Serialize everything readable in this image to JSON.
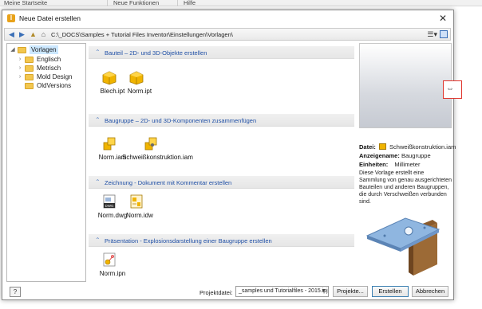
{
  "background_menu": {
    "items": [
      "Meine Startseite",
      "Neue Funktionen",
      "Hilfe"
    ]
  },
  "dialog": {
    "title": "Neue Datei erstellen",
    "close_glyph": "✕",
    "title_icon_text": "I"
  },
  "address": {
    "path": "C:\\_DOCS\\Samples + Tutorial Files Inventor\\Einstellungen\\Vorlagen\\",
    "icons": [
      "back-arrow-icon",
      "forward-arrow-icon",
      "up-folder-icon",
      "home-icon"
    ]
  },
  "tree": {
    "root": "Vorlagen",
    "children": [
      "Englisch",
      "Metrisch",
      "Mold Design",
      "OldVersions"
    ]
  },
  "sections": [
    {
      "heading": "Bauteil – 2D- und 3D-Objekte erstellen",
      "files": [
        {
          "name": "Blech.ipt",
          "icon": "part-sheet-icon"
        },
        {
          "name": "Norm.ipt",
          "icon": "part-icon"
        }
      ]
    },
    {
      "heading": "Baugruppe – 2D- und 3D-Komponenten zusammenfügen",
      "files": [
        {
          "name": "Norm.iam",
          "icon": "assembly-icon"
        },
        {
          "name": "Schweißkonstruktion.iam",
          "icon": "weldment-icon"
        }
      ]
    },
    {
      "heading": "Zeichnung - Dokument mit Kommentar erstellen",
      "files": [
        {
          "name": "Norm.dwg",
          "icon": "dwg-icon"
        },
        {
          "name": "Norm.idw",
          "icon": "idw-icon"
        }
      ]
    },
    {
      "heading": "Präsentation - Explosionsdarstellung einer Baugruppe erstellen",
      "files": [
        {
          "name": "Norm.ipn",
          "icon": "presentation-icon"
        }
      ]
    }
  ],
  "preview": {
    "file_label": "Datei:",
    "file_value": "Schweißkonstruktion.iam",
    "display_label": "Anzeigename:",
    "display_value": "Baugruppe",
    "units_label": "Einheiten:",
    "units_value": "Millimeter",
    "description": "Diese Vorlage erstellt eine Sammlung von genau ausgerichteten Bauteilen und anderen Baugruppen, die durch Verschweißen verbunden sind."
  },
  "footer": {
    "help_label": "?",
    "project_label": "Projektdatei:",
    "project_value": "_samples und Tutorialfiles - 2015.ipj",
    "projects_button": "Projekte...",
    "create_button": "Erstellen",
    "cancel_button": "Abbrechen"
  },
  "colors": {
    "section_text": "#1f4fa5",
    "accent_highlight": "#e0342c",
    "folder": "#f3c74f"
  }
}
